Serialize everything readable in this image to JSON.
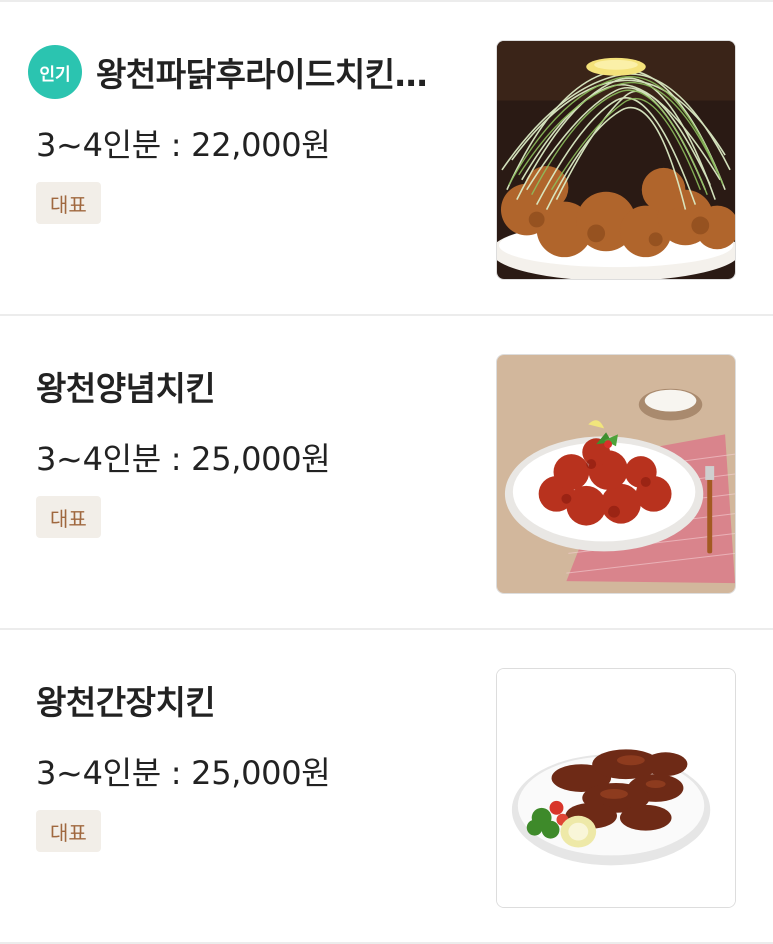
{
  "menu_items": [
    {
      "popular_badge": "인기",
      "name": "왕천파닭후라이드치킨…",
      "price_text": "3~4인분 : 22,000원",
      "tag": "대표",
      "image": "fried-chicken-with-green-onion-photo"
    },
    {
      "name": "왕천양념치킨",
      "price_text": "3~4인분 : 25,000원",
      "tag": "대표",
      "image": "seasoned-chicken-photo"
    },
    {
      "name": "왕천간장치킨",
      "price_text": "3~4인분 : 25,000원",
      "tag": "대표",
      "image": "soy-sauce-chicken-photo"
    }
  ],
  "colors": {
    "popular_badge": "#2bc4b0",
    "tag_background": "#f2eee8",
    "tag_text": "#a0683f",
    "divider": "#ececec"
  }
}
